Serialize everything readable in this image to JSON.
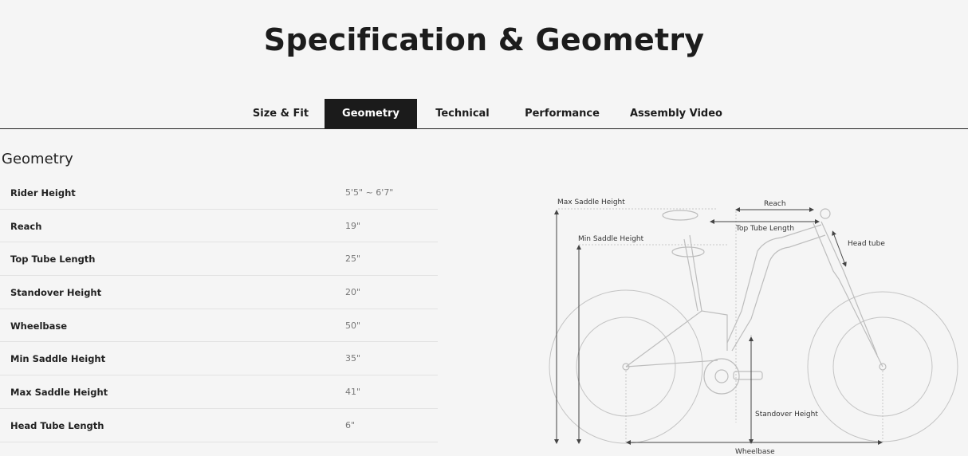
{
  "page": {
    "title": "Specification & Geometry"
  },
  "tabs": [
    {
      "label": "Size & Fit",
      "active": false
    },
    {
      "label": "Geometry",
      "active": true
    },
    {
      "label": "Technical",
      "active": false
    },
    {
      "label": "Performance",
      "active": false
    },
    {
      "label": "Assembly Video",
      "active": false
    }
  ],
  "geometry": {
    "title": "Geometry",
    "rows": [
      {
        "label": "Rider Height",
        "value": "5'5\" ~ 6'7\""
      },
      {
        "label": "Reach",
        "value": "19\""
      },
      {
        "label": "Top Tube Length",
        "value": "25\""
      },
      {
        "label": "Standover Height",
        "value": "20\""
      },
      {
        "label": "Wheelbase",
        "value": "50\""
      },
      {
        "label": "Min Saddle Height",
        "value": "35\""
      },
      {
        "label": "Max Saddle Height",
        "value": "41\""
      },
      {
        "label": "Head Tube Length",
        "value": "6\""
      }
    ]
  },
  "diagram": {
    "labels": {
      "max_saddle": "Max Saddle Height",
      "min_saddle": "Min Saddle Height",
      "reach": "Reach",
      "top_tube": "Top Tube Length",
      "head_tube": "Head tube",
      "standover": "Standover Height",
      "wheelbase": "Wheelbase"
    }
  },
  "colors": {
    "active_tab_bg": "#1b1b1b",
    "page_bg": "#f5f5f5"
  }
}
